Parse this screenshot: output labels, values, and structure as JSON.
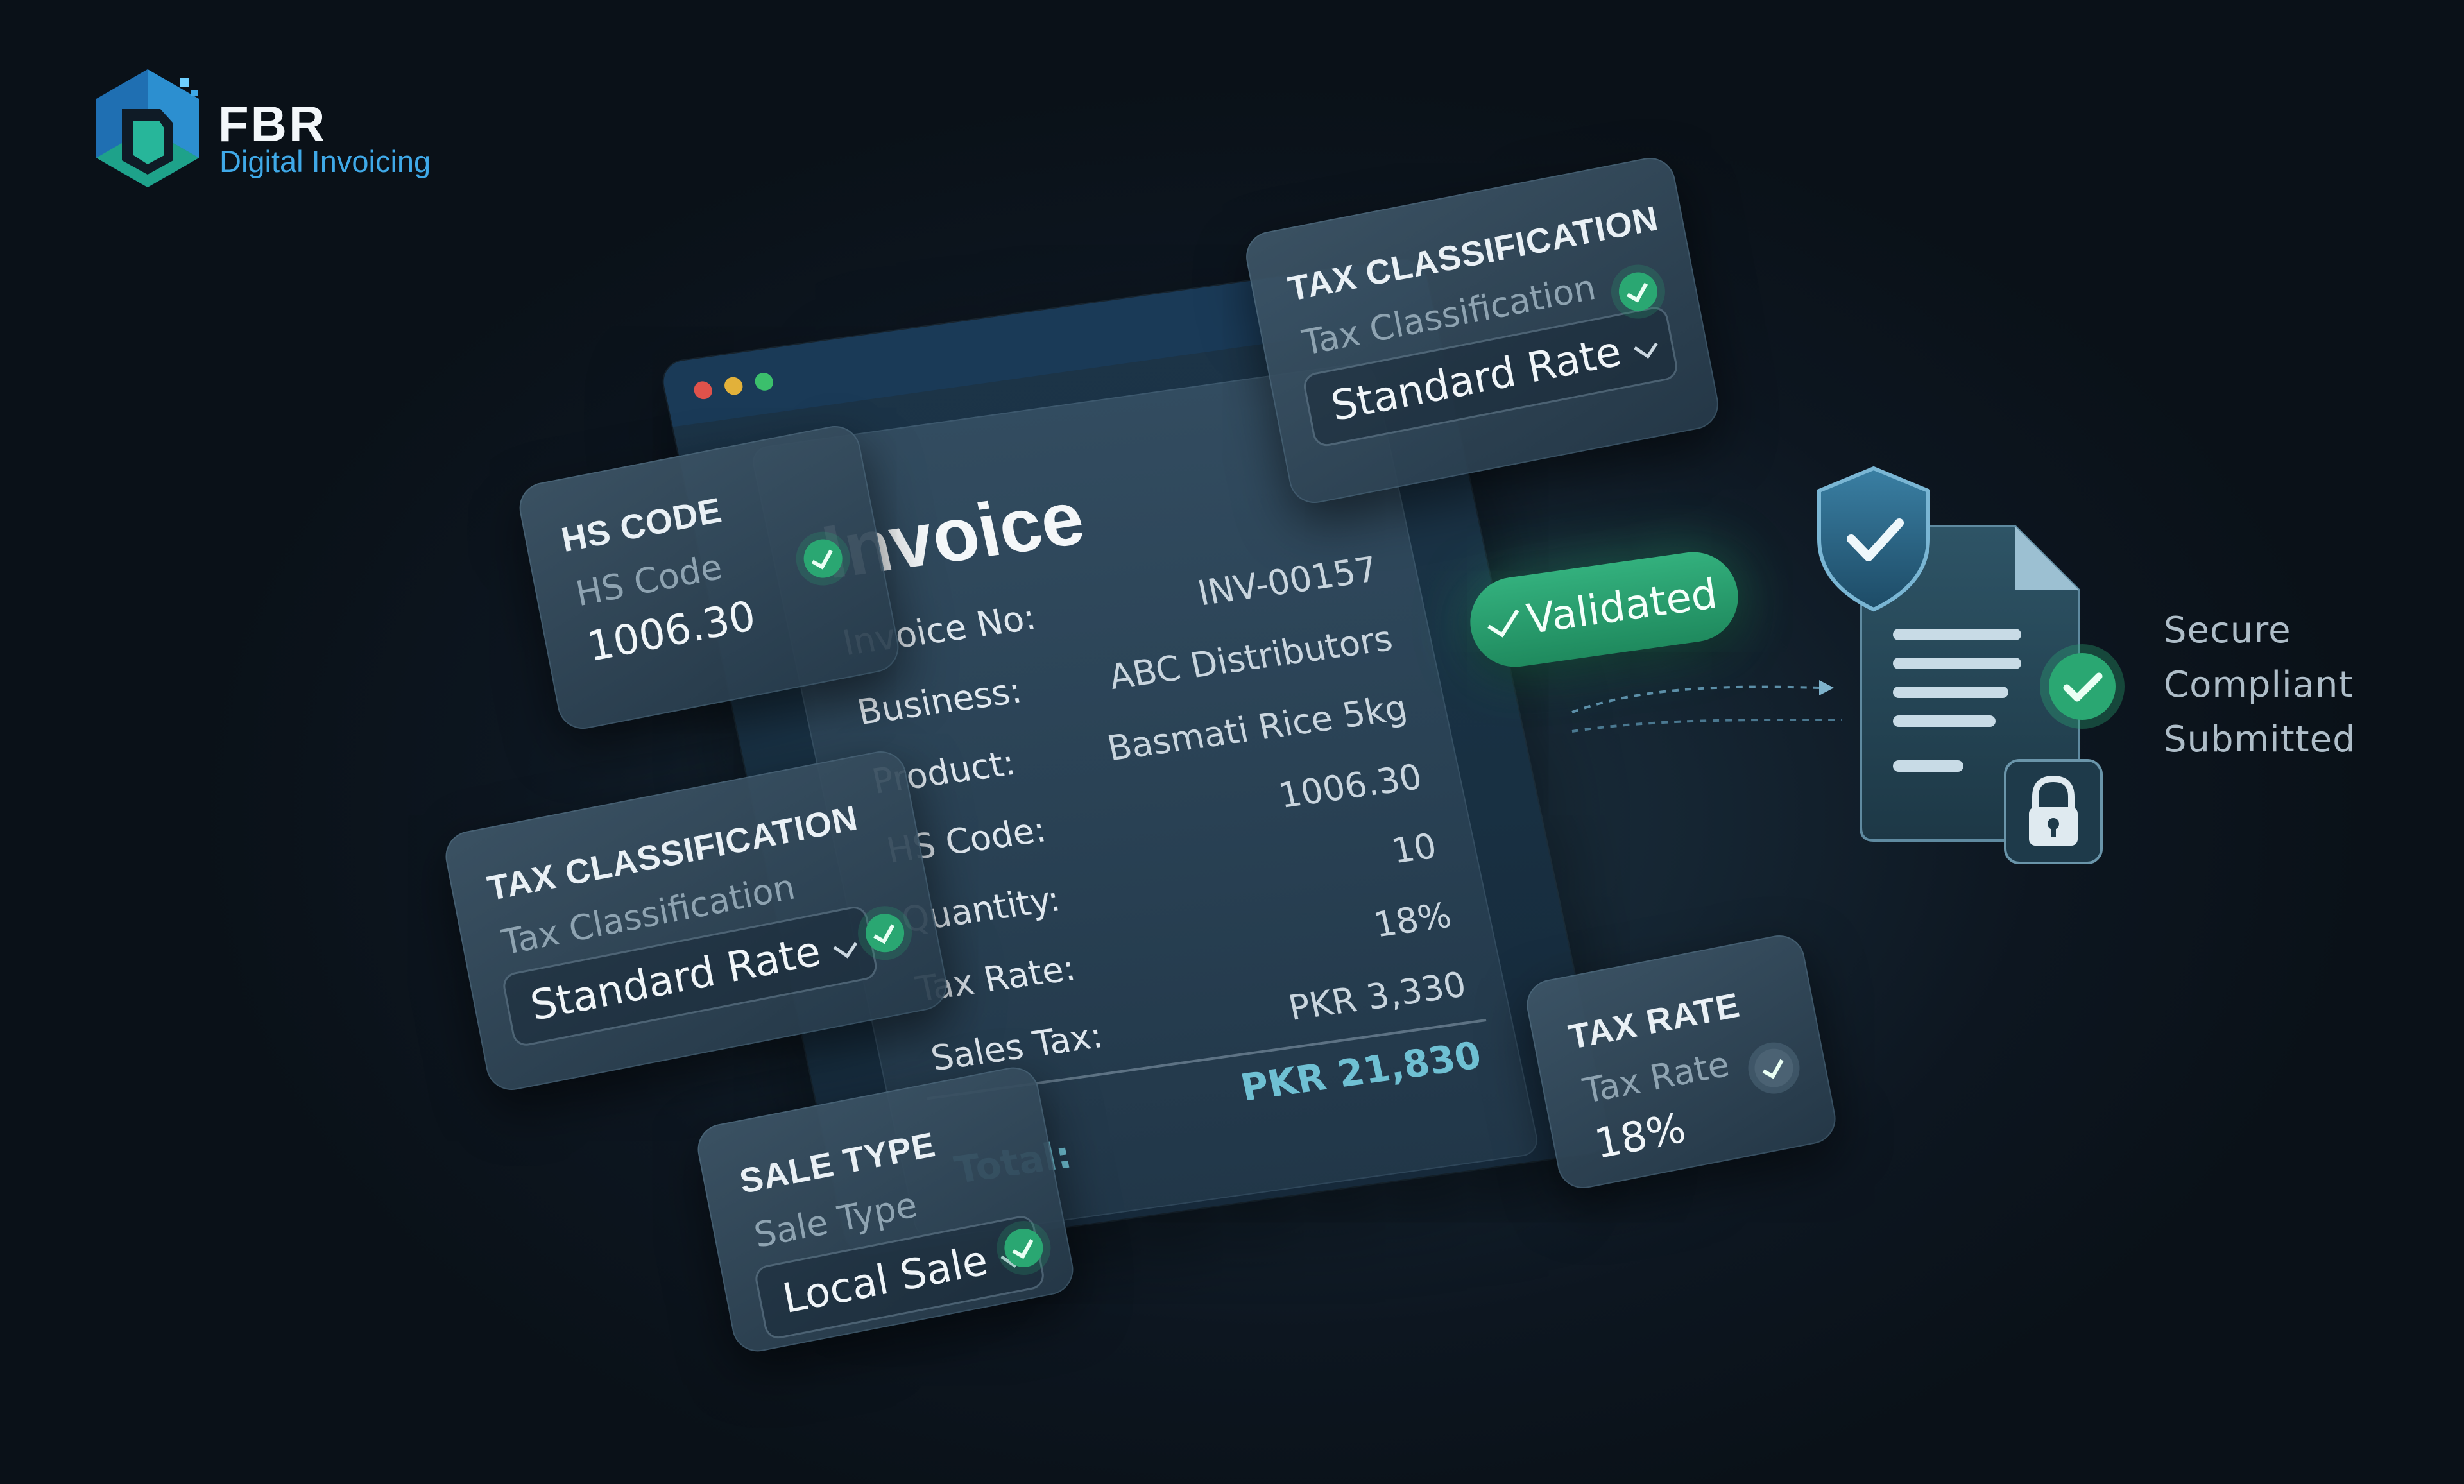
{
  "logo": {
    "brand": "FBR",
    "subtitle": "Digital Invoicing"
  },
  "invoice": {
    "title": "Invoice",
    "rows": [
      {
        "label": "Invoice No:",
        "value": "INV-00157"
      },
      {
        "label": "Business:",
        "value": "ABC Distributors"
      },
      {
        "label": "Product:",
        "value": "Basmati Rice 5kg"
      },
      {
        "label": "HS Code:",
        "value": "1006.30"
      },
      {
        "label": "Quantity:",
        "value": "10"
      },
      {
        "label": "Tax Rate:",
        "value": "18%"
      },
      {
        "label": "Sales Tax:",
        "value": "PKR 3,330"
      }
    ],
    "total_label": "Total:",
    "total_value": "PKR 21,830"
  },
  "cards": {
    "hs_code": {
      "title": "HS CODE",
      "label": "HS Code",
      "value": "1006.30"
    },
    "tax_top": {
      "title": "TAX CLASSIFICATION",
      "label": "Tax Classification",
      "selected": "Standard Rate"
    },
    "tax_left": {
      "title": "TAX CLASSIFICATION",
      "label": "Tax Classification",
      "selected": "Standard Rate"
    },
    "sale_type": {
      "title": "SALE TYPE",
      "label": "Sale Type",
      "selected": "Local Sale"
    },
    "tax_rate": {
      "title": "TAX RATE",
      "label": "Tax Rate",
      "value": "18%"
    }
  },
  "status": {
    "validated": "Validated"
  },
  "taglines": [
    "Secure",
    "Compliant",
    "Submitted"
  ],
  "icons": {
    "logo": "fbr-hexagon-logo-icon",
    "check": "check-circle-icon",
    "chevron": "chevron-down-icon",
    "shield": "shield-check-icon",
    "document": "document-icon",
    "lock": "lock-icon"
  },
  "colors": {
    "accent_green": "#2aa772",
    "accent_blue": "#3fa9e8",
    "total_teal": "#6fc0d3",
    "window_red": "#e0524b",
    "window_yellow": "#e2b13a",
    "window_green": "#3bbf6c"
  }
}
